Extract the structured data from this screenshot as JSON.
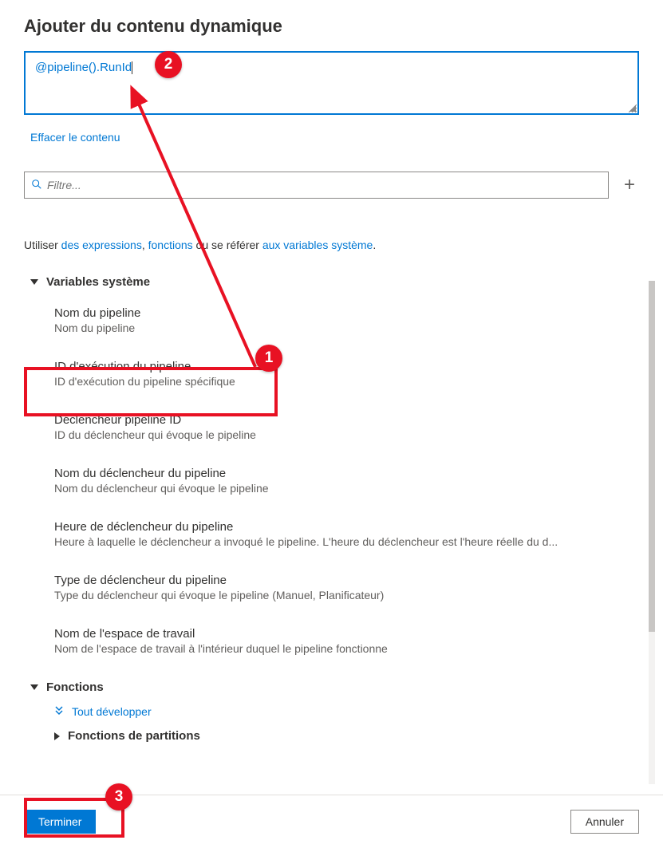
{
  "header": {
    "title": "Ajouter du contenu dynamique"
  },
  "expression": {
    "value": "@pipeline().RunId"
  },
  "clear_link": "Effacer le contenu",
  "filter": {
    "placeholder": "Filtre..."
  },
  "help": {
    "prefix": "Utiliser ",
    "link1": "des expressions",
    "sep1": ", ",
    "link2": "fonctions",
    "mid": " ou se référer ",
    "link3": "aux variables système",
    "suffix": "."
  },
  "sections": {
    "system_vars": {
      "label": "Variables système",
      "items": [
        {
          "title": "Nom du pipeline",
          "desc": "Nom du pipeline"
        },
        {
          "title": "ID d'exécution du pipeline",
          "desc": "ID d'exécution du pipeline spécifique"
        },
        {
          "title": "Déclencheur pipeline ID",
          "desc": "ID du déclencheur qui évoque le pipeline"
        },
        {
          "title": "Nom du déclencheur du pipeline",
          "desc": "Nom du déclencheur qui évoque le pipeline"
        },
        {
          "title": "Heure de déclencheur du pipeline",
          "desc": "Heure à laquelle le déclencheur a invoqué le pipeline. L'heure du déclencheur est l'heure réelle du d..."
        },
        {
          "title": "Type de déclencheur du pipeline",
          "desc": "Type du déclencheur qui évoque le pipeline (Manuel, Planificateur)"
        },
        {
          "title": "Nom de l'espace de travail",
          "desc": "Nom de l'espace de travail à l'intérieur duquel le pipeline fonctionne"
        }
      ]
    },
    "functions": {
      "label": "Fonctions",
      "expand_all": "Tout développer",
      "sub": "Fonctions de partitions"
    }
  },
  "footer": {
    "finish": "Terminer",
    "cancel": "Annuler"
  },
  "callouts": {
    "c1": "1",
    "c2": "2",
    "c3": "3"
  }
}
